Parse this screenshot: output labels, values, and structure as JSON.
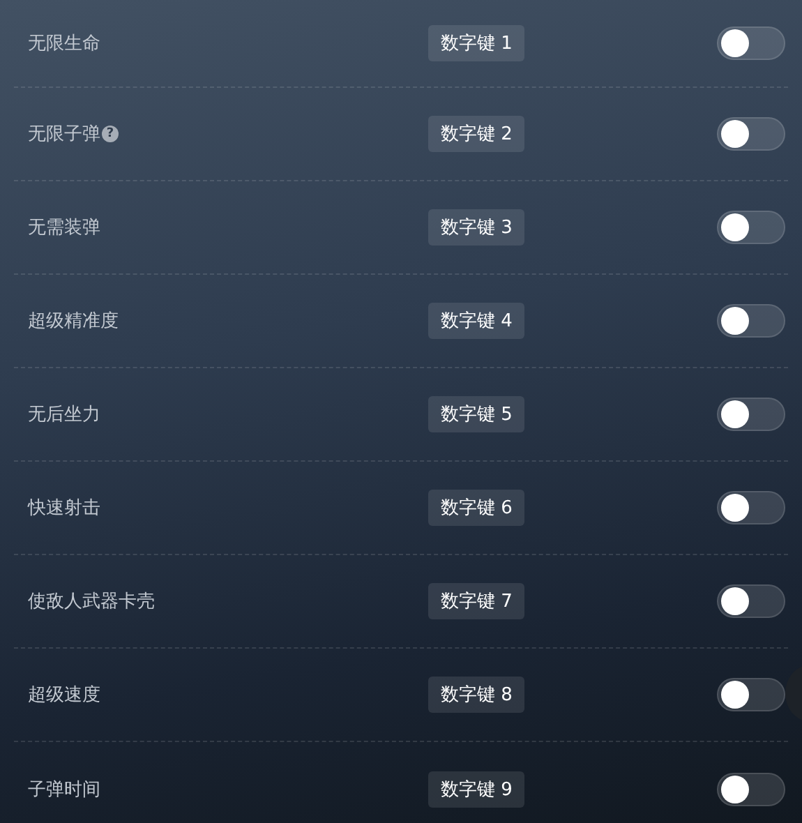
{
  "cheats": [
    {
      "name": "无限生命",
      "key": "数字键 1",
      "on": false
    },
    {
      "name": "无限子弹",
      "help": "?",
      "key": "数字键 2",
      "on": false
    },
    {
      "name": "无需装弹",
      "key": "数字键 3",
      "on": false
    },
    {
      "name": "超级精准度",
      "key": "数字键 4",
      "on": false
    },
    {
      "name": "无后坐力",
      "key": "数字键 5",
      "on": false
    },
    {
      "name": "快速射击",
      "key": "数字键 6",
      "on": false
    },
    {
      "name": "使敌人武器卡壳",
      "key": "数字键 7",
      "on": false
    },
    {
      "name": "超级速度",
      "key": "数字键 8",
      "on": false
    },
    {
      "name": "子弹时间",
      "key": "数字键 9",
      "on": false
    }
  ]
}
